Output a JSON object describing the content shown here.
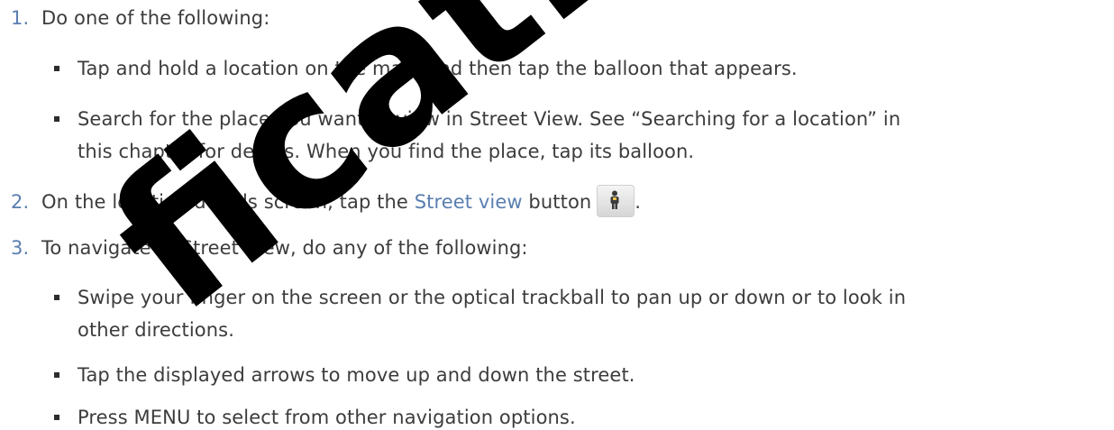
{
  "steps": [
    {
      "number": "1.",
      "text": "Do one of the following:",
      "bullets": [
        {
          "text": "Tap and hold a location on the map, and then tap the balloon that appears."
        },
        {
          "text": "Search for the place you want to view in Street View. See “Searching for a location” in"
        },
        {
          "text": "this chapter for details. When you find the place, tap its balloon."
        }
      ]
    },
    {
      "number": "2.",
      "text_before": "On the location details screen, tap the ",
      "highlight": "Street view",
      "text_after": " button",
      "trailing": "."
    },
    {
      "number": "3.",
      "text": "To navigate in Street View, do any of the following:",
      "bullets": [
        {
          "text": "Swipe your finger on the screen or the optical trackball to pan up or down or to look in"
        },
        {
          "text": "other directions."
        },
        {
          "text": "Tap the displayed arrows to move up and down the street."
        },
        {
          "text": "Press MENU to select from other navigation options."
        }
      ]
    }
  ],
  "icons": {
    "street_view_button": "street-view-person-icon"
  },
  "watermark": {
    "text": "fication Or"
  },
  "colors": {
    "text": "#3c3c3c",
    "accent": "#5a7fb0",
    "watermark": "#000000"
  }
}
